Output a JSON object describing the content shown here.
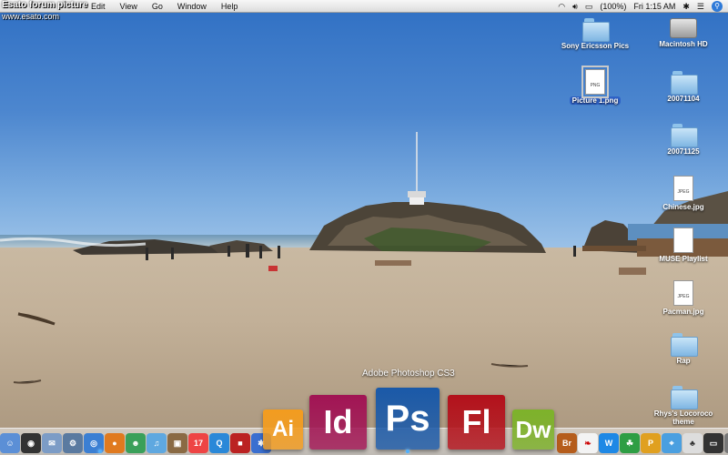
{
  "watermark": {
    "title": "Esato forum picture",
    "url": "www.esato.com"
  },
  "menubar": {
    "apple": "",
    "menus": [
      "Edit",
      "View",
      "Go",
      "Window",
      "Help"
    ],
    "battery": "(100%)",
    "clock": "Fri 1:15 AM"
  },
  "desktop_icons": {
    "sony": "Sony Ericsson Pics",
    "macintosh": "Macintosh HD",
    "picture1": "Picture 1.png",
    "folder1": "20071104",
    "folder2": "20071125",
    "chinese": "Chinese.jpg",
    "muse": "MUSE Playlist",
    "pacman": "Pacman.jpg",
    "rap": "Rap",
    "rhys": "Rhys's Locoroco theme",
    "png_tag": "PNG",
    "jpeg_tag": "JPEG"
  },
  "dock": {
    "tooltip": "Adobe Photoshop CS3",
    "magnified": {
      "ai": "Ai",
      "id": "Id",
      "ps": "Ps",
      "fl": "Fl",
      "dw": "Dw",
      "br": "Br"
    },
    "colors": {
      "ai": "#f39c1f",
      "id": "#a11454",
      "ps": "#1a59a8",
      "fl": "#b3111b",
      "dw": "#7db22a",
      "br": "#b55d1c"
    }
  }
}
